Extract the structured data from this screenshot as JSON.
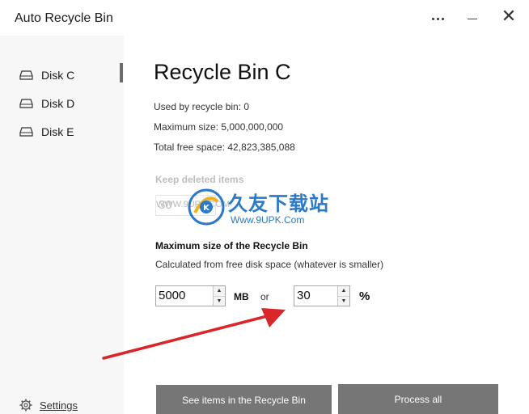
{
  "window": {
    "title": "Auto Recycle Bin",
    "more_icon": "more-horizontal-icon",
    "minimize_icon": "minimize-icon",
    "close_glyph": "✕"
  },
  "sidebar": {
    "items": [
      {
        "label": "Disk C",
        "icon": "disk-drive-icon",
        "active": true
      },
      {
        "label": "Disk D",
        "icon": "disk-drive-icon",
        "active": false
      },
      {
        "label": "Disk E",
        "icon": "disk-drive-icon",
        "active": false
      }
    ],
    "settings_label": "Settings",
    "settings_icon": "gear-icon"
  },
  "main": {
    "title": "Recycle Bin C",
    "used_line": "Used by recycle bin: 0",
    "max_line": "Maximum size: 5,000,000,000",
    "free_line": "Total free space: 42,823,385,088",
    "keep_heading": "Keep deleted items",
    "keep_value": "30",
    "max_heading": "Maximum size of the Recycle Bin",
    "max_desc": "Calculated from free disk space (whatever is smaller)",
    "mb_value": "5000",
    "mb_unit": "MB",
    "or_label": "or",
    "pct_value": "30",
    "pct_unit": "%",
    "see_items_button": "See items in the Recycle Bin",
    "process_all_button": "Process all"
  },
  "overlay": {
    "watermark_main": "久友下载站",
    "watermark_url": "Www.9UPK.Com",
    "watermark_faint": "WWW.9UPK.COM",
    "arrow_color": "#d9262b"
  },
  "colors": {
    "sidebar_bg": "#f7f7f7",
    "button_bg": "#767676",
    "accent": "#2a7ac9"
  }
}
